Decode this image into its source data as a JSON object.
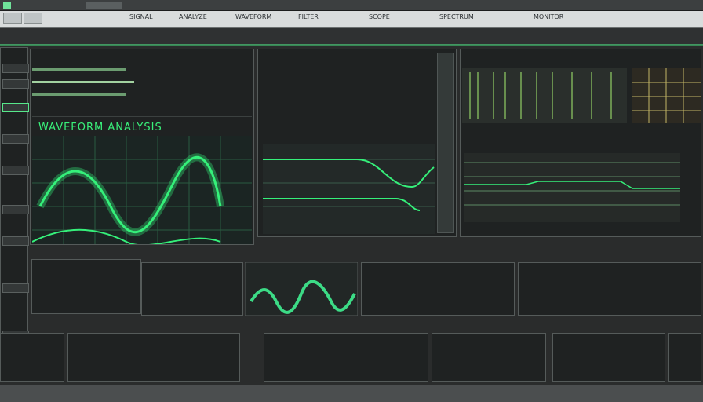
{
  "toolbar": {
    "items": [
      "SIGNAL",
      "ANALYZE",
      "WAVEFORM",
      "FILTER",
      "SCOPE",
      "SPECTRUM",
      "MONITOR"
    ]
  },
  "main_panel": {
    "title": "WAVEFORM ANALYSIS"
  },
  "colors": {
    "accent": "#35f07a",
    "background": "#2a2c2c",
    "panel": "#1f2222",
    "toolbar": "#d9dcdc"
  },
  "icons": [
    "grid-icon",
    "waveform-icon",
    "bar-meter-icon"
  ]
}
